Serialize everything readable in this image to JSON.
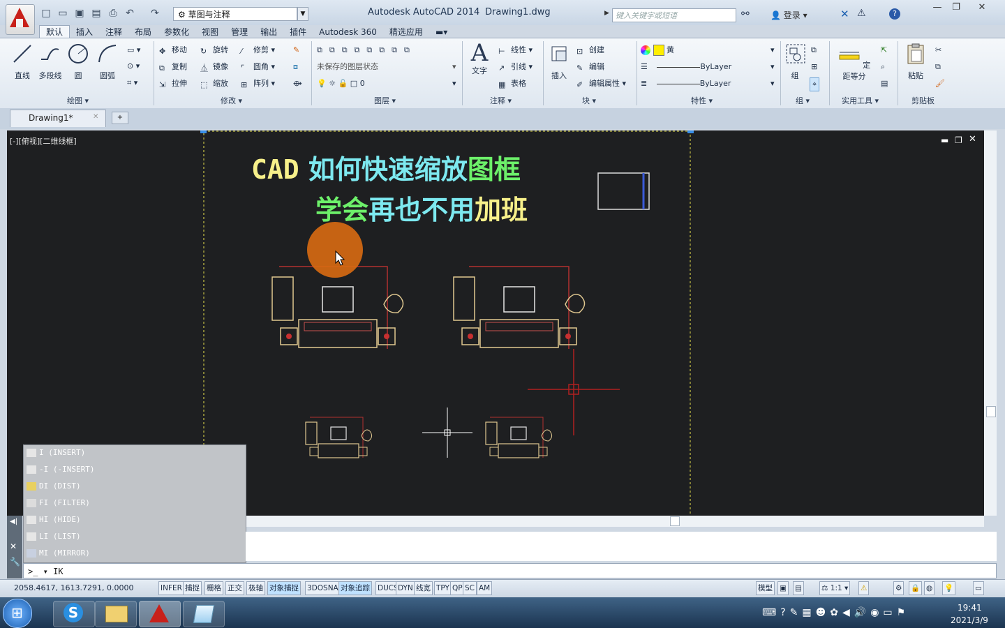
{
  "window": {
    "app_title": "Autodesk AutoCAD 2014",
    "doc_title": "Drawing1.dwg",
    "workspace": "草图与注释",
    "search_placeholder": "键入关键字或短语",
    "login": "登录",
    "help": "?"
  },
  "ribbon_tabs": [
    "默认",
    "插入",
    "注释",
    "布局",
    "参数化",
    "视图",
    "管理",
    "输出",
    "插件",
    "Autodesk 360",
    "精选应用"
  ],
  "ribbon": {
    "draw": {
      "line": "直线",
      "polyline": "多段线",
      "circle": "圆",
      "arc": "圆弧",
      "panel": "绘图 ▾"
    },
    "modify": {
      "move": "移动",
      "rotate": "旋转",
      "trim": "修剪",
      "copy": "复制",
      "mirror": "镜像",
      "fillet": "圆角",
      "stretch": "拉伸",
      "scale": "缩放",
      "array": "阵列",
      "panel": "修改 ▾"
    },
    "layers": {
      "state": "未保存的图层状态",
      "layer": "0",
      "panel": "图层 ▾"
    },
    "annotation": {
      "text": "文字",
      "linear": "线性",
      "leader": "引线",
      "table": "表格",
      "panel": "注释 ▾"
    },
    "block": {
      "insert": "插入",
      "create": "创建",
      "edit": "编辑",
      "edit_attr": "编辑属性",
      "panel": "块 ▾"
    },
    "properties": {
      "color": "黄",
      "linetype": "ByLayer",
      "lineweight": "ByLayer",
      "panel": "特性 ▾"
    },
    "groups": {
      "group": "组",
      "panel": "组 ▾"
    },
    "utilities": {
      "measure": "定距等分",
      "panel": "实用工具 ▾"
    },
    "clipboard": {
      "paste": "粘贴",
      "panel": "剪贴板"
    }
  },
  "doc_tab": "Drawing1*",
  "viewport": {
    "label": "[-][俯视][二维线框]",
    "title_line1_a": "CAD",
    "title_line1_b": "如何快速",
    "title_line1_c": "缩放",
    "title_line1_d": "图框",
    "title_line2_a": "学会",
    "title_line2_b": "再也不用",
    "title_line2_c": "加班"
  },
  "autocomplete": [
    {
      "text": "I (INSERT)",
      "icon": "insert-icon"
    },
    {
      "text": "-I (-INSERT)",
      "icon": "insert-icon"
    },
    {
      "text": "DI (DIST)",
      "icon": "dist-icon"
    },
    {
      "text": "FI (FILTER)",
      "icon": "filter-icon"
    },
    {
      "text": "HI (HIDE)",
      "icon": "hide-icon"
    },
    {
      "text": "LI (LIST)",
      "icon": "list-icon"
    },
    {
      "text": "MI (MIRROR)",
      "icon": "mirror-icon"
    }
  ],
  "command_line": ">_ ▾ IK",
  "status": {
    "coords": "2058.4617, 1613.7291, 0.0000",
    "toggles": [
      "INFER",
      "捕捉",
      "栅格",
      "正交",
      "极轴",
      "对象捕捉",
      "3DOSNAP",
      "对象追踪",
      "DUCS",
      "DYN",
      "线宽",
      "TPY",
      "QP",
      "SC",
      "AM"
    ],
    "active_toggles": [
      "对象捕捉",
      "对象追踪"
    ],
    "model": "模型",
    "scale": "1:1"
  },
  "taskbar": {
    "time": "19:41",
    "date": "2021/3/9"
  },
  "colors": {
    "yellow": "#f7f08a",
    "cyan": "#7de9f0",
    "white": "#f2f2f2",
    "green": "#6df06a",
    "cad_red": "#c8201a",
    "highlight": "#d86a12"
  }
}
